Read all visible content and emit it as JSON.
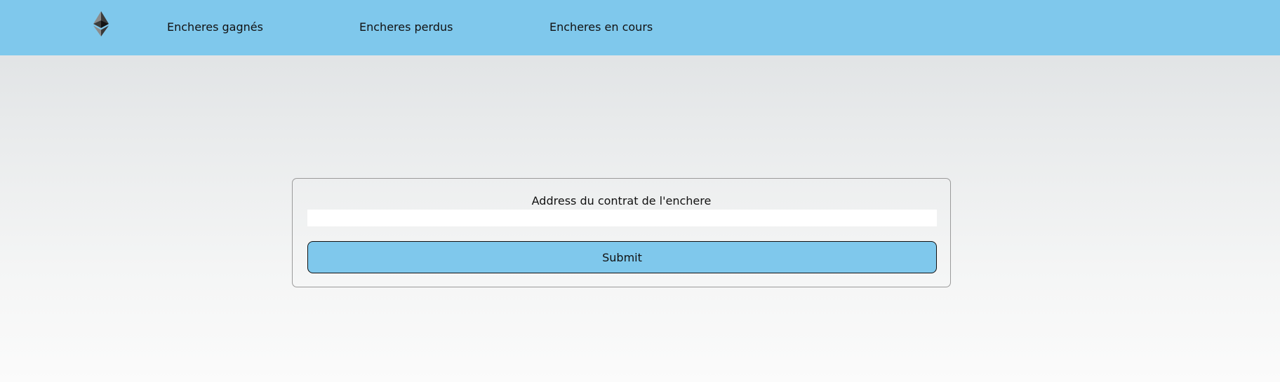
{
  "navbar": {
    "logo_icon": "ethereum-icon",
    "links": [
      {
        "label": "Encheres gagnés"
      },
      {
        "label": "Encheres perdus"
      },
      {
        "label": "Encheres en cours"
      }
    ],
    "background_color": "#7fc8ec"
  },
  "form": {
    "address_label": "Address du contrat de l'enchere",
    "address_value": "",
    "address_placeholder": "",
    "submit_label": "Submit",
    "button_color": "#7fc8ec"
  }
}
